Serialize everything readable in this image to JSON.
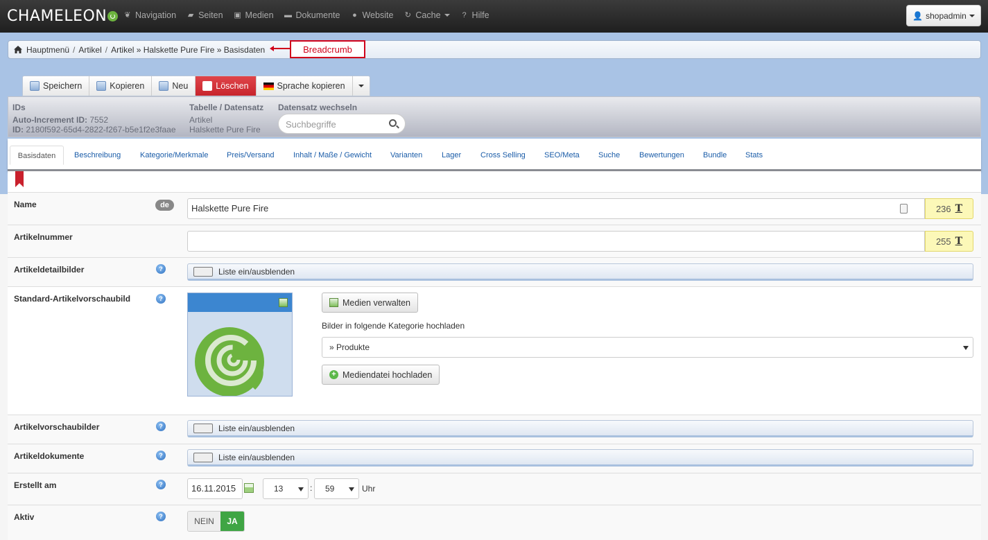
{
  "app": {
    "logo_text": "CHAMELEON"
  },
  "topnav": {
    "items": [
      {
        "label": "Navigation",
        "icon": "leaf-icon"
      },
      {
        "label": "Seiten",
        "icon": "folder-icon"
      },
      {
        "label": "Medien",
        "icon": "image-icon"
      },
      {
        "label": "Dokumente",
        "icon": "document-icon"
      },
      {
        "label": "Website",
        "icon": "globe-icon"
      },
      {
        "label": "Cache",
        "icon": "refresh-icon"
      },
      {
        "label": "Hilfe",
        "icon": "question-icon"
      }
    ],
    "user": "shopadmin"
  },
  "breadcrumb": {
    "items": [
      "Hauptmenü",
      "Artikel",
      "Artikel » Halskette Pure Fire » Basisdaten"
    ],
    "annotation": "Breadcrumb"
  },
  "toolbar": {
    "save": "Speichern",
    "copy": "Kopieren",
    "new": "Neu",
    "delete": "Löschen",
    "copy_language": "Sprache kopieren"
  },
  "info": {
    "ids_heading": "IDs",
    "auto_increment_label": "Auto-Increment ID:",
    "auto_increment_value": "7552",
    "id_label": "ID:",
    "id_value": "2180f592-65d4-2822-f267-b5e1f2e3faae",
    "table_heading": "Tabelle / Datensatz",
    "table_value": "Artikel",
    "record_value": "Halskette Pure Fire",
    "switch_heading": "Datensatz wechseln",
    "search_placeholder": "Suchbegriffe"
  },
  "tabs": [
    "Basisdaten",
    "Beschreibung",
    "Kategorie/Merkmale",
    "Preis/Versand",
    "Inhalt / Maße / Gewicht",
    "Varianten",
    "Lager",
    "Cross Selling",
    "SEO/Meta",
    "Suche",
    "Bewertungen",
    "Bundle",
    "Stats"
  ],
  "form": {
    "name_label": "Name",
    "lang_badge": "de",
    "name_value": "Halskette Pure Fire",
    "name_remaining": "236",
    "artnr_label": "Artikelnummer",
    "artnr_value": "",
    "artnr_remaining": "255",
    "detail_images_label": "Artikeldetailbilder",
    "toggle_list": "Liste ein/ausblenden",
    "preview_label": "Standard-Artikelvorschaubild",
    "manage_media": "Medien verwalten",
    "upload_category_label": "Bilder in folgende Kategorie hochladen",
    "upload_category_value": "» Produkte",
    "upload_media": "Mediendatei hochladen",
    "preview_images_label": "Artikelvorschaubilder",
    "documents_label": "Artikeldokumente",
    "created_label": "Erstellt am",
    "created_date": "16.11.2015",
    "created_hour": "13",
    "created_colon": ":",
    "created_minute": "59",
    "created_unit": "Uhr",
    "active_label": "Aktiv",
    "active_no": "NEIN",
    "active_yes": "JA"
  },
  "colors": {
    "brand_green": "#6db33f",
    "danger": "#c7242c",
    "band_blue": "#a9c3e5",
    "active_green": "#3fa544"
  }
}
